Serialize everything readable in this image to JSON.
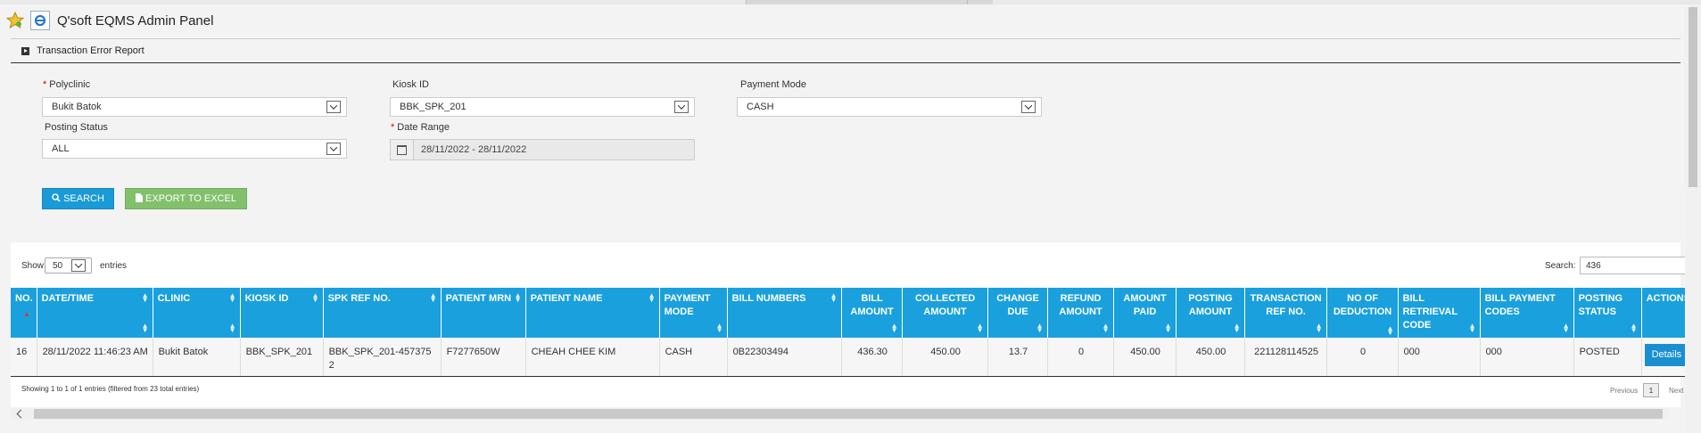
{
  "app": {
    "title": "Q'soft EQMS Admin Panel"
  },
  "panel": {
    "title": "Transaction Error Report"
  },
  "filters": {
    "polyclinic": {
      "label": "Polyclinic",
      "required": "*",
      "value": "Bukit Batok"
    },
    "kiosk_id": {
      "label": "Kiosk ID",
      "value": "BBK_SPK_201"
    },
    "payment_mode": {
      "label": "Payment Mode",
      "value": "CASH"
    },
    "posting_status": {
      "label": "Posting Status",
      "value": "ALL"
    },
    "date_range": {
      "label": "Date Range",
      "required": "*",
      "value": "28/11/2022 - 28/11/2022"
    }
  },
  "buttons": {
    "search": "SEARCH",
    "export": "EXPORT TO EXCEL"
  },
  "table_controls": {
    "show_label": "Show",
    "page_length": "50",
    "entries_label": "entries",
    "search_label": "Search:",
    "search_value": "436"
  },
  "columns": [
    "NO.",
    "DATE/TIME",
    "CLINIC",
    "KIOSK ID",
    "SPK REF NO.",
    "PATIENT MRN",
    "PATIENT NAME",
    "PAYMENT MODE",
    "BILL NUMBERS",
    "BILL AMOUNT",
    "COLLECTED AMOUNT",
    "CHANGE DUE",
    "REFUND AMOUNT",
    "AMOUNT PAID",
    "POSTING AMOUNT",
    "TRANSACTION REF NO.",
    "NO OF DEDUCTION",
    "BILL RETRIEVAL CODE",
    "BILL PAYMENT CODES",
    "POSTING STATUS",
    "ACTIONS"
  ],
  "rows": [
    {
      "no": "16",
      "datetime": "28/11/2022 11:46:23 AM",
      "clinic": "Bukit Batok",
      "kiosk_id": "BBK_SPK_201",
      "spk_ref": "BBK_SPK_201-4573752",
      "mrn": "F7277650W",
      "name": "CHEAH CHEE KIM",
      "payment_mode": "CASH",
      "bill_numbers": "0B22303494",
      "bill_amount": "436.30",
      "collected": "450.00",
      "change_due": "13.7",
      "refund": "0",
      "amount_paid": "450.00",
      "posting_amount": "450.00",
      "txn_ref": "221128114525",
      "deductions": "0",
      "retrieval_code": "000",
      "payment_codes": "000",
      "posting_status": "POSTED",
      "action": "Details"
    }
  ],
  "footer": {
    "info": "Showing 1 to 1 of 1 entries (filtered from 23 total entries)",
    "previous": "Previous",
    "page": "1",
    "next": "Next"
  },
  "colors": {
    "header": "#1aa0dd",
    "search_button": "#1a9ad6",
    "export_button": "#82c06b"
  }
}
